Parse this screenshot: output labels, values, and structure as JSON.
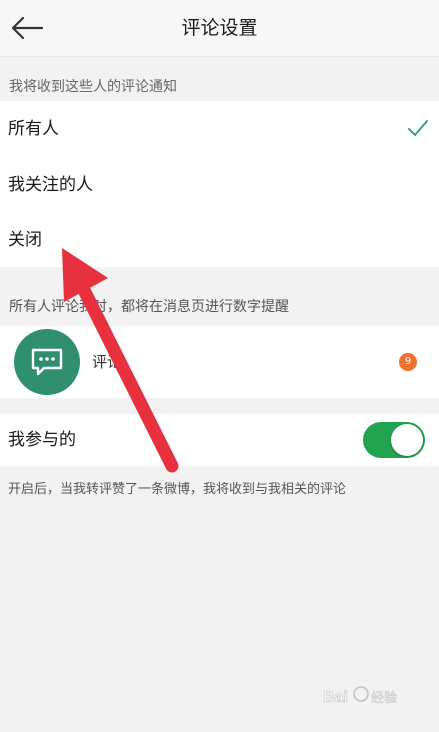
{
  "header": {
    "title": "评论设置",
    "back_icon": "arrow-left-icon"
  },
  "section_receive": {
    "label": "我将收到这些人的评论通知",
    "options": [
      {
        "label": "所有人",
        "selected": true
      },
      {
        "label": "我关注的人",
        "selected": false
      },
      {
        "label": "关闭",
        "selected": false
      }
    ],
    "check_color": "#3aa57a"
  },
  "notice": {
    "text": "所有人评论我时，都将在消息页进行数字提醒"
  },
  "preview": {
    "icon": "chat-bubble-icon",
    "label": "评论",
    "badge": "9",
    "badge_color": "#f07030",
    "icon_bg": "#2f8f6f"
  },
  "participate": {
    "label": "我参与的",
    "enabled": true,
    "toggle_color": "#21a350",
    "footnote": "开启后，当我转评赞了一条微博，我将收到与我相关的评论"
  },
  "annotation": {
    "arrow_color": "#e8313f"
  },
  "watermark": {
    "text": "Bai 经验"
  }
}
